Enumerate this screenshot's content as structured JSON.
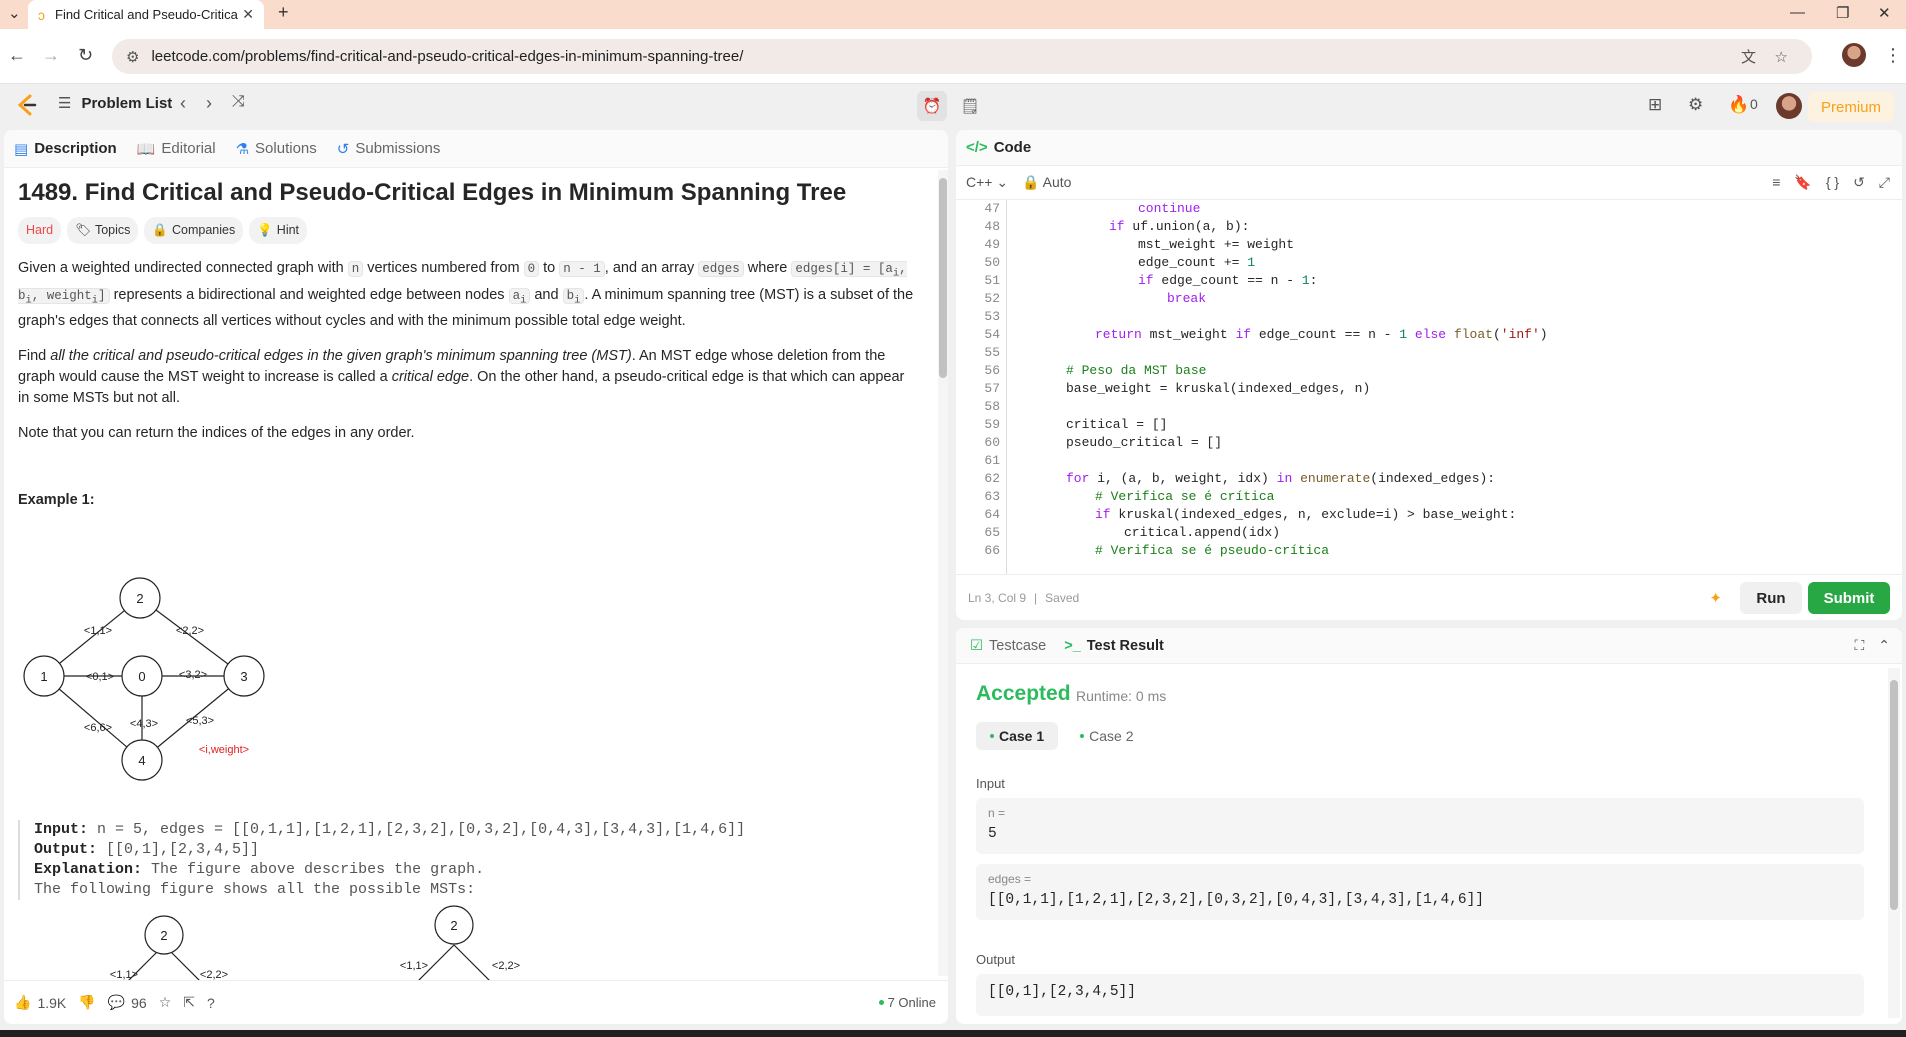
{
  "browser": {
    "tab_title": "Find Critical and Pseudo-Critica",
    "url": "leetcode.com/problems/find-critical-and-pseudo-critical-edges-in-minimum-spanning-tree/"
  },
  "topbar": {
    "problem_list": "Problem List",
    "streak": "0",
    "premium": "Premium"
  },
  "left_tabs": [
    "Description",
    "Editorial",
    "Solutions",
    "Submissions"
  ],
  "problem": {
    "title": "1489. Find Critical and Pseudo-Critical Edges in Minimum Spanning Tree",
    "difficulty": "Hard",
    "tags": [
      "Topics",
      "Companies",
      "Hint"
    ],
    "p1_a": "Given a weighted undirected connected graph with ",
    "p1_n": "n",
    "p1_b": " vertices numbered from ",
    "p1_zero": "0",
    "p1_c": " to ",
    "p1_nm1": "n - 1",
    "p1_d": ", and an array ",
    "p1_edges": "edges",
    "p1_e": " where ",
    "p1_edgesi": "edges[i] = [a",
    "p1_f": " represents a bidirectional and weighted edge between nodes ",
    "p1_ai": "a",
    "p1_and": " and ",
    "p1_bi": "b",
    "p1_g": ". A minimum spanning tree (MST) is a subset of the graph's edges that connects all vertices without cycles and with the minimum possible total edge weight.",
    "p2_a": "Find ",
    "p2_em": "all the critical and pseudo-critical edges in the given graph's minimum spanning tree (MST)",
    "p2_b": ". An MST edge whose deletion from the graph would cause the MST weight to increase is called a ",
    "p2_em2": "critical edge",
    "p2_c": ". On the other hand, a pseudo-critical edge is that which can appear in some MSTs but not all.",
    "p3": "Note that you can return the indices of the edges in any order.",
    "example_title": "Example 1:",
    "input_label": "Input:",
    "input_val": " n = 5, edges = [[0,1,1],[1,2,1],[2,3,2],[0,3,2],[0,4,3],[3,4,3],[1,4,6]]",
    "output_label": "Output:",
    "output_val": " [[0,1],[2,3,4,5]]",
    "explanation_label": "Explanation:",
    "explanation_val": " The figure above describes the graph.",
    "explanation_line2": "The following figure shows all the possible MSTs:"
  },
  "graph": {
    "nodes": [
      "2",
      "1",
      "0",
      "3",
      "4"
    ],
    "edge_labels": [
      "<1,1>",
      "<2,2>",
      "<0,1>",
      "<3,2>",
      "<6,6>",
      "<4,3>",
      "<5,3>"
    ],
    "legend": "<i,weight>"
  },
  "left_bottom": {
    "likes": "1.9K",
    "comments": "96",
    "online": "7 Online"
  },
  "code": {
    "header": "Code",
    "language": "C++",
    "mode": "Auto",
    "status_pos": "Ln 3, Col 9",
    "status_saved": "Saved",
    "run": "Run",
    "submit": "Submit"
  },
  "result": {
    "tabs": [
      "Testcase",
      "Test Result"
    ],
    "status": "Accepted",
    "runtime": "Runtime: 0 ms",
    "cases": [
      "Case 1",
      "Case 2"
    ],
    "input_label": "Input",
    "n_key": "n =",
    "n_val": "5",
    "edges_key": "edges =",
    "edges_val": "[[0,1,1],[1,2,1],[2,3,2],[0,3,2],[0,4,3],[3,4,3],[1,4,6]]",
    "output_label": "Output",
    "output_val": "[[0,1],[2,3,4,5]]"
  }
}
